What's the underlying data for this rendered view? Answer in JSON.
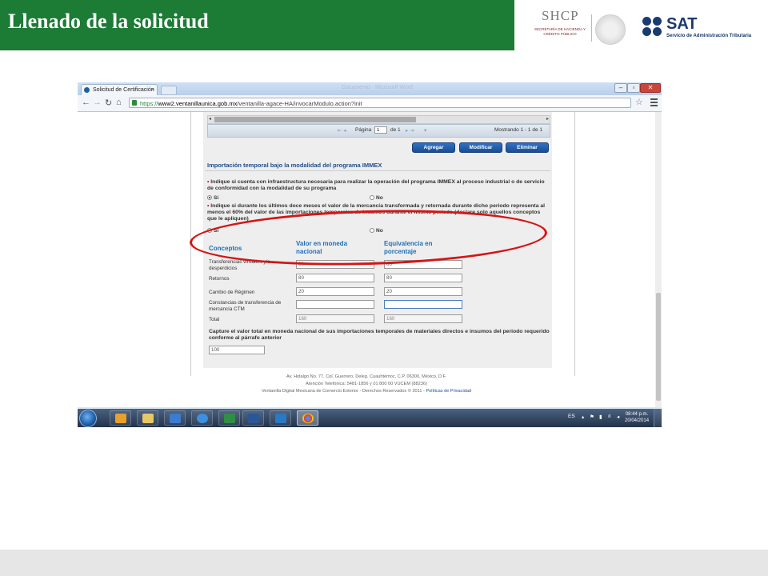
{
  "slide": {
    "title": "Llenado de la solicitud",
    "logos": {
      "shcp_word": "SHCP",
      "shcp_sub": "SECRETARÍA DE HACIENDA Y CRÉDITO PÚBLICO",
      "sat_word": "SAT",
      "sat_sub": "Servicio de Administración Tributaria"
    }
  },
  "browser": {
    "tab_title": "Solicitud de Certificación",
    "url_scheme": "https://",
    "url_host": "www2.ventanillaunica.gob.mx",
    "url_path": "/ventanilla-agace-HA/invocarModulo.action?init",
    "title_ghost": "Documento - Microsoft Word"
  },
  "pager": {
    "page_label": "Página",
    "page_value": "1",
    "of_label": "de 1",
    "range": "Mostrando 1 - 1 de 1"
  },
  "buttons": {
    "add": "Agregar",
    "modify": "Modificar",
    "delete": "Eliminar"
  },
  "section": {
    "title": "Importación temporal bajo la modalidad del programa IMMEX",
    "q1": "Indique si cuenta con infraestructura necesaria para realizar la operación del programa IMMEX al proceso industrial o de servicio de conformidad con la modalidad de su programa",
    "q2": "Indique si durante los últimos doce meses el valor de la mercancía transformada y retornada durante dicho periodo representa al menos el 60% del valor de las importaciones temporales de insumos durante el mismo periodo (declare solo aquellos conceptos que le apliquen)",
    "yes": "Sí",
    "no": "No"
  },
  "table": {
    "col_concepts": "Conceptos",
    "col_value": "Valor en moneda nacional",
    "col_percent": "Equivalencia en porcentaje",
    "rows": [
      {
        "label": "Transferencias virtuales y/o desperdicios",
        "value": "60",
        "percent": "60"
      },
      {
        "label": "Retornos",
        "value": "80",
        "percent": "80"
      },
      {
        "label": "Cambio de Régimen",
        "value": "20",
        "percent": "20"
      },
      {
        "label": "Constancias de transferencia de mercancía CTM",
        "value": "",
        "percent": ""
      },
      {
        "label": "Total",
        "value": "160",
        "percent": "160"
      }
    ]
  },
  "capture": {
    "text": "Capture el valor total en moneda nacional de sus importaciones temporales de materiales directos e insumos del periodo requerido conforme al párrafo anterior",
    "value": "100"
  },
  "footer": {
    "line1": "Av. Hidalgo No. 77, Col. Guerrero, Deleg. Cuauhtémoc, C.P. 06300, México, D.F.",
    "line2": "Atención Telefónica: 5481-1856 y 01 800 00 VUCEM (88236)",
    "line3": "Ventanilla Digital Mexicana de Comercio Exterior - Derechos Reservados © 2011 -",
    "privacy": "Políticas de Privacidad"
  },
  "taskbar": {
    "lang": "ES",
    "time": "08:44 p.m.",
    "date": "20/04/2014"
  },
  "colors": {
    "header_green": "#1c7b35",
    "highlight_red": "#d41515",
    "button_blue": "#1a4d95",
    "heading_blue": "#1e6fb6"
  }
}
